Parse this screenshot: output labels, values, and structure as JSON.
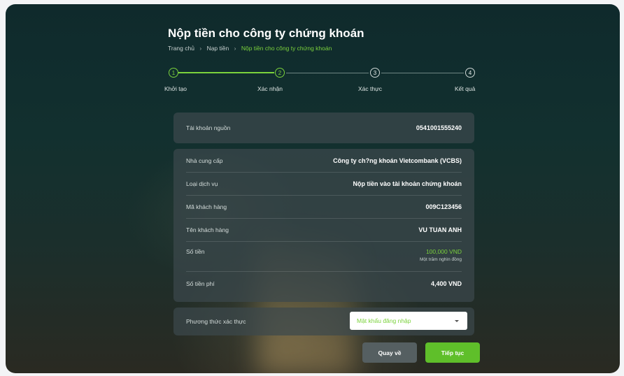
{
  "page": {
    "title": "Nộp tiền cho công ty chứng khoán",
    "breadcrumb": [
      "Trang chủ",
      "Nạp tiền",
      "Nộp tiền cho công ty chứng khoán"
    ],
    "breadcrumb_separator": "›"
  },
  "stepper": {
    "steps": [
      {
        "number": "1",
        "label": "Khởi tạo",
        "done": true
      },
      {
        "number": "2",
        "label": "Xác nhận",
        "done": true
      },
      {
        "number": "3",
        "label": "Xác thực",
        "done": false
      },
      {
        "number": "4",
        "label": "Kết quả",
        "done": false
      }
    ]
  },
  "source": {
    "label": "Tài khoản nguồn",
    "value": "0541001555240"
  },
  "details": {
    "provider_label": "Nhà cung cấp",
    "provider_value": "Công ty ch?ng khoán Vietcombank (VCBS)",
    "service_label": "Loại dịch vụ",
    "service_value": "Nộp tiền vào tài khoản chứng khoán",
    "customer_code_label": "Mã khách hàng",
    "customer_code_value": "009C123456",
    "customer_name_label": "Tên khách hàng",
    "customer_name_value": "VU TUAN ANH",
    "amount_label": "Số tiền",
    "amount_value": "100,000 VND",
    "amount_words": "Một trăm nghìn đồng",
    "fee_label": "Số tiền phí",
    "fee_value": "4,400 VND"
  },
  "auth": {
    "label": "Phương thức xác thực",
    "selected": "Mật khẩu đăng nhập"
  },
  "buttons": {
    "back": "Quay về",
    "next": "Tiếp tục"
  },
  "colors": {
    "accent": "#7bd23c",
    "primary_button": "#5fbf2a",
    "secondary_button": "#555f61"
  }
}
